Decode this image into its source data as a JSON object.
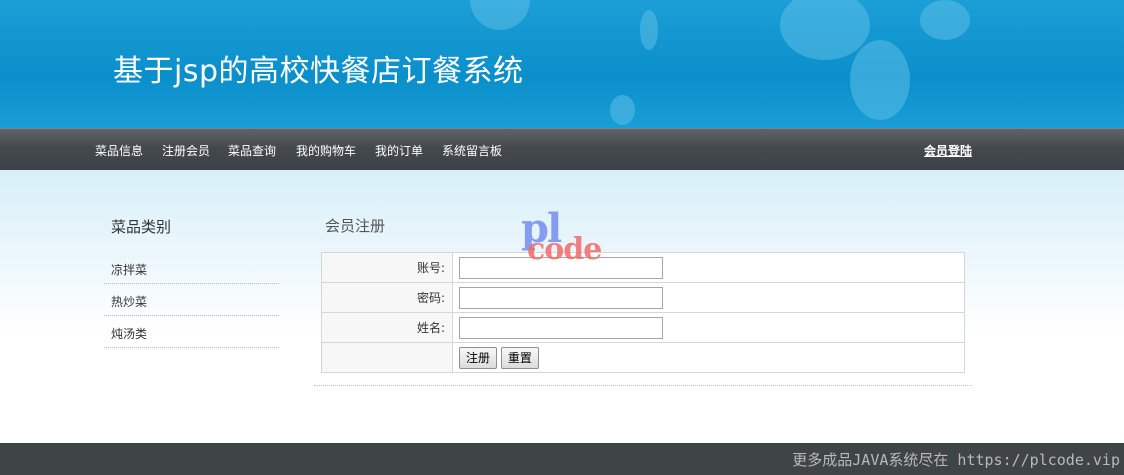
{
  "header": {
    "site_title": "基于jsp的高校快餐店订餐系统"
  },
  "nav": {
    "items": [
      "菜品信息",
      "注册会员",
      "菜品查询",
      "我的购物车",
      "我的订单",
      "系统留言板"
    ],
    "login_label": "会员登陆"
  },
  "sidebar": {
    "title": "菜品类别",
    "categories": [
      "凉拌菜",
      "热炒菜",
      "炖汤类"
    ]
  },
  "register_form": {
    "title": "会员注册",
    "fields": [
      {
        "label": "账号:",
        "value": ""
      },
      {
        "label": "密码:",
        "value": ""
      },
      {
        "label": "姓名:",
        "value": ""
      }
    ],
    "submit_label": "注册",
    "reset_label": "重置"
  },
  "watermark": {
    "line1": "pl",
    "line2": "code"
  },
  "footer": {
    "text": "更多成品JAVA系统尽在 https://plcode.vip"
  },
  "colors": {
    "header_blue": "#1c9fd6",
    "nav_dark": "#44494d",
    "footer_dark": "#3f4447"
  }
}
